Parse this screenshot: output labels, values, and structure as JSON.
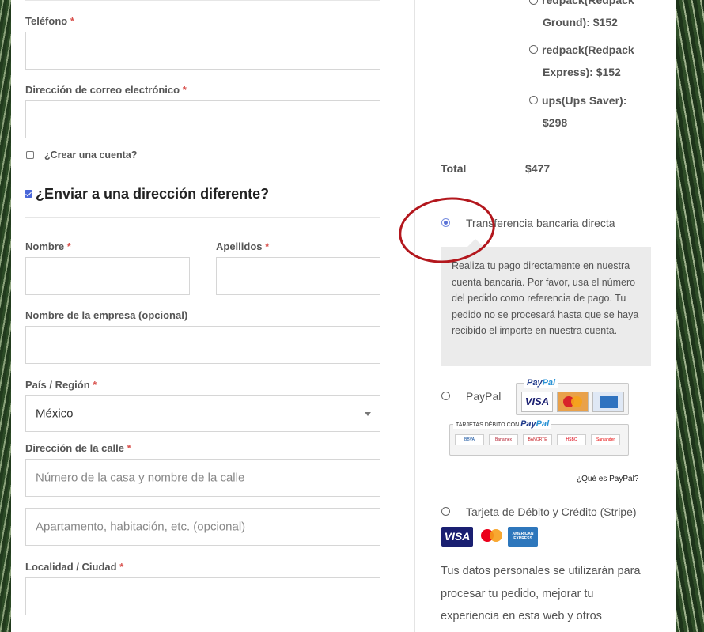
{
  "billing": {
    "telefono_label": "Teléfono",
    "email_label": "Dirección de correo electrónico",
    "create_account_label": "¿Crear una cuenta?",
    "required_mark": "*"
  },
  "shipping_section": {
    "title": "¿Enviar a una dirección diferente?",
    "checked": true,
    "nombre_label": "Nombre",
    "apellidos_label": "Apellidos",
    "empresa_label": "Nombre de la empresa (opcional)",
    "pais_label": "País / Región",
    "pais_value": "México",
    "calle_label": "Dirección de la calle",
    "calle_placeholder": "Número de la casa y nombre de la calle",
    "apartamento_placeholder": "Apartamento, habitación, etc. (opcional)",
    "ciudad_label": "Localidad / Ciudad"
  },
  "order": {
    "shipping_options": [
      {
        "line1": "redpack(Redpack",
        "line2": "Ground): $152"
      },
      {
        "line1": "redpack(Redpack",
        "line2": "Express): $152"
      },
      {
        "line1": "ups(Ups Saver):",
        "line2": "$298"
      }
    ],
    "total_label": "Total",
    "total_value": "$477"
  },
  "payment": {
    "bank_transfer_label": "Transferencia bancaria directa",
    "bank_transfer_desc": "Realiza tu pago directamente en nuestra cuenta bancaria. Por favor, usa el número del pedido como referencia de pago. Tu pedido no se procesará hasta que se haya recibido el importe en nuestra cuenta.",
    "paypal_label": "PayPal",
    "paypal_logo_a": "Pay",
    "paypal_logo_b": "Pal",
    "paypal_debit_caption": "TARJETAS DÉBITO CON",
    "visa": "VISA",
    "banks": [
      "BBVA Bancomer",
      "Banamex",
      "BANORTE",
      "HSBC",
      "Santander"
    ],
    "what_is_paypal": "¿Qué es PayPal?",
    "stripe_label": "Tarjeta de Débito y Crédito (Stripe)",
    "amex": "AMERICAN EXPRESS"
  },
  "privacy_text": "Tus datos personales se utilizarán para procesar tu pedido, mejorar tu experiencia en esta web y otros",
  "colors": {
    "accent": "#4a67d9",
    "required": "#d9534f",
    "annotation": "#b3171d"
  }
}
